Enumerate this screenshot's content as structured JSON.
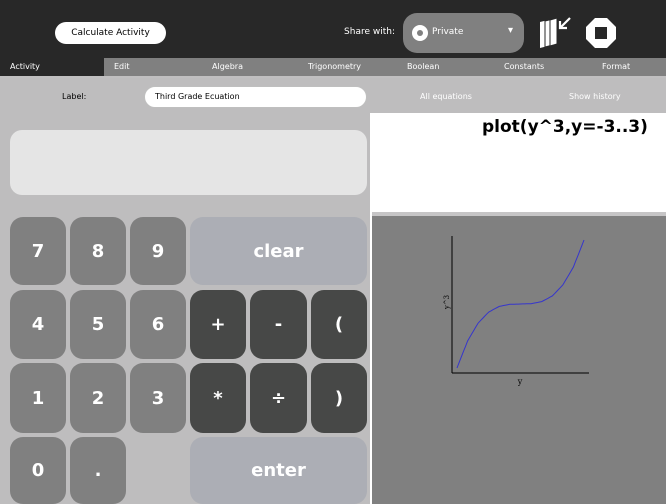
{
  "toolbar": {
    "activity_name": "Calculate Activity",
    "share_label": "Share with:",
    "share_value": "Private"
  },
  "tabs": [
    "Activity",
    "Edit",
    "Algebra",
    "Trigonometry",
    "Boolean",
    "Constants",
    "Format"
  ],
  "selected_tab": "Activity",
  "label_row": {
    "label": "Label:",
    "value": "Third Grade Ecuation",
    "all_equations": "All equations",
    "show_history": "Show history"
  },
  "display": {
    "value": ""
  },
  "keypad": {
    "k7": "7",
    "k8": "8",
    "k9": "9",
    "clear": "clear",
    "k4": "4",
    "k5": "5",
    "k6": "6",
    "plus": "+",
    "minus": "-",
    "lparen": "(",
    "k1": "1",
    "k2": "2",
    "k3": "3",
    "times": "*",
    "divide": "÷",
    "rparen": ")",
    "k0": "0",
    "dot": ".",
    "enter": "enter"
  },
  "output": {
    "expression": "plot(y^3,y=-3..3)"
  },
  "chart_data": {
    "type": "line",
    "xlabel": "y",
    "ylabel": "y^3",
    "xlim": [
      -3,
      3
    ],
    "ylim": [
      -27,
      27
    ],
    "series": [
      {
        "x": [
          -3,
          -2.5,
          -2,
          -1.5,
          -1,
          -0.5,
          0,
          0.5,
          1,
          1.5,
          2,
          2.5,
          3
        ],
        "values": [
          -27,
          -15.625,
          -8,
          -3.375,
          -1,
          -0.125,
          0,
          0.125,
          1,
          3.375,
          8,
          15.625,
          27
        ],
        "color": "#3535cc"
      }
    ],
    "grid": false
  },
  "colors": {
    "toolbar": "#282828",
    "tabbar": "#808080",
    "panel": "#bebdbe",
    "num_key": "#808080",
    "op_key": "#474847",
    "wide_key": "#acaeb5"
  }
}
